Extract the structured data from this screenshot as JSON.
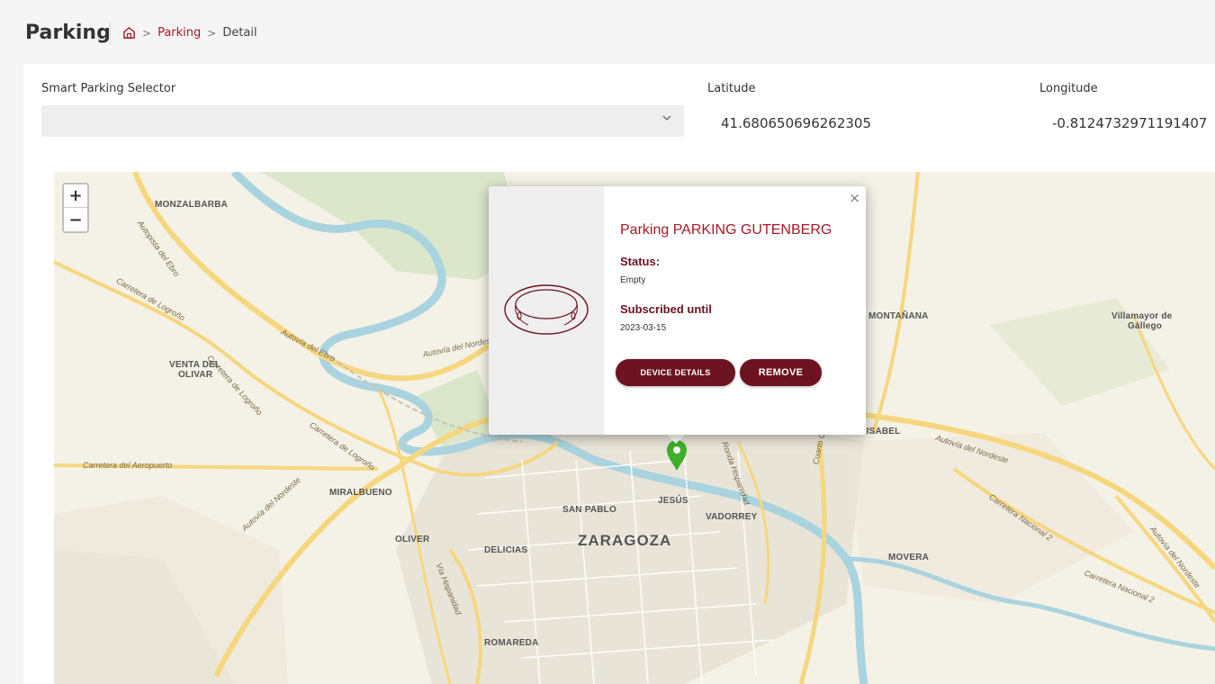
{
  "header": {
    "title": "Parking",
    "breadcrumb": {
      "home_icon": "home-icon",
      "separator": ">",
      "items": [
        "Parking",
        "Detail"
      ]
    }
  },
  "form": {
    "selector_label": "Smart Parking Selector",
    "selector_value": "",
    "latitude_label": "Latitude",
    "latitude_value": "41.680650696262305",
    "longitude_label": "Longitude",
    "longitude_value": "-0.8124732971191407"
  },
  "map": {
    "zoom_in": "+",
    "zoom_out": "−",
    "places": {
      "monzalbarba": "MONZALBARBA",
      "venta_del_olivar_1": "VENTA DEL",
      "venta_del_olivar_2": "OLIVAR",
      "montanana": "MONTAÑANA",
      "villamayor_1": "Villamayor de",
      "villamayor_2": "Gállego",
      "santa_isabel": "TA ISABEL",
      "miralbueno": "MIRALBUENO",
      "oliver": "OLIVER",
      "delicias": "DELICIAS",
      "san_pablo": "SAN PABLO",
      "jesus": "JESÚS",
      "vadorrey": "VADORREY",
      "zaragoza": "ZARAGOZA",
      "movera": "MOVERA",
      "romareda": "ROMAREDA"
    },
    "roads": {
      "autopista_ebro": "Autopista del Ebro",
      "ctra_logrono_1": "Carretera de Logroño",
      "autovia_ebro": "Autovía del Ebro",
      "autovia_nordeste_1": "Autovía del Nordeste",
      "ctra_logrono_2": "Carretera de Logroño",
      "ctra_logrono_3": "Carretera de Logroño",
      "ctra_aeropuerto": "Carretera del Aeropuerto",
      "autovia_nordeste_2": "Autovía del Nordeste",
      "autovia_nordeste_3": "Autovía del Nordeste",
      "ctra_nacional_1": "Carretera Nacional 2",
      "ctra_nacional_2": "Carretera Nacional 2",
      "autovia_nordeste_4": "Autovía del Nordeste",
      "ronda_hispanidad": "Ronda Hispanidad",
      "cuarto_cinturon": "Cuarto Cinturón de Zaragoza",
      "via_hispanidad": "Vía Hispanidad"
    },
    "marker_icon": "map-pin-icon",
    "marker_color": "#3fae2a"
  },
  "popup": {
    "close": "×",
    "image_icon": "parking-sensor-icon",
    "title": "Parking PARKING GUTENBERG",
    "status_label": "Status:",
    "status_value": "Empty",
    "subscribed_label": "Subscribed until",
    "subscribed_value": "2023-03-15",
    "details_button": "DEVICE DETAILS",
    "remove_button": "REMOVE"
  },
  "colors": {
    "accent": "#a61a26",
    "button": "#6d1220"
  }
}
